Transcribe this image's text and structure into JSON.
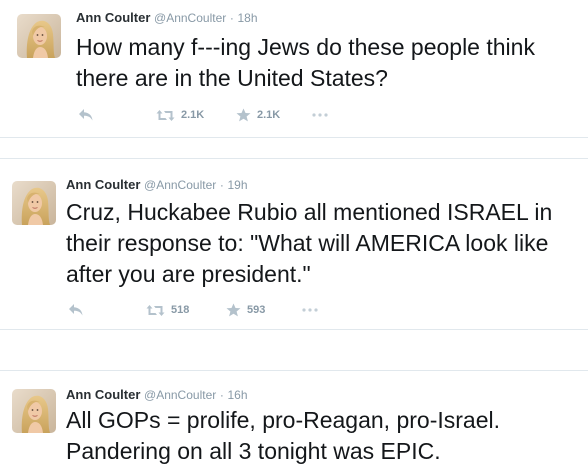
{
  "colors": {
    "accent_grey": "#8899a6",
    "text": "#14171a",
    "divider": "#e1e8ed"
  },
  "tweets": [
    {
      "fullname": "Ann Coulter",
      "username": "@AnnCoulter",
      "separator": "·",
      "time": "18h",
      "text": "How many f---ing Jews do these people think there are in the United States?",
      "retweets": "2.1K",
      "favorites": "2.1K",
      "icons": [
        "reply-icon",
        "retweet-icon",
        "star-icon",
        "more-icon"
      ]
    },
    {
      "fullname": "Ann Coulter",
      "username": "@AnnCoulter",
      "separator": "·",
      "time": "19h",
      "text": "Cruz, Huckabee Rubio all mentioned ISRAEL in their response to: \"What will AMERICA look like after you are president.\"",
      "retweets": "518",
      "favorites": "593",
      "icons": [
        "reply-icon",
        "retweet-icon",
        "star-icon",
        "more-icon"
      ]
    },
    {
      "fullname": "Ann Coulter",
      "username": "@AnnCoulter",
      "separator": "·",
      "time": "16h",
      "text": "All GOPs = prolife, pro-Reagan, pro-Israel. Pandering on all 3 tonight was EPIC."
    }
  ]
}
